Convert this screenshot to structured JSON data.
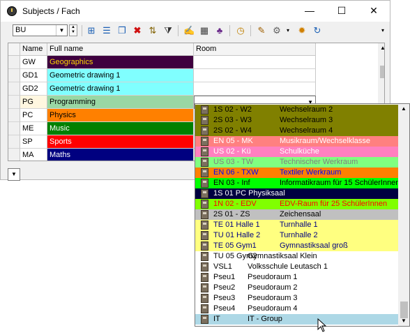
{
  "window": {
    "title": "Subjects / Fach",
    "min_glyph": "—",
    "max_glyph": "☐",
    "close_glyph": "✕"
  },
  "toolbar": {
    "combo_value": "BU"
  },
  "grid": {
    "columns": [
      "Name",
      "Full name",
      "Room"
    ],
    "rows": [
      {
        "name": "GW",
        "full": "Geographics",
        "bg": "#3f003f",
        "fg": "#ffd700"
      },
      {
        "name": "GD1",
        "full": "Geometric drawing 1",
        "bg": "#80ffff",
        "fg": "#000000"
      },
      {
        "name": "GD2",
        "full": "Geometric drawing 1",
        "bg": "#80ffff",
        "fg": "#000000"
      },
      {
        "name": "PG",
        "full": "Programming",
        "bg": "#99d7a4",
        "fg": "#000000"
      },
      {
        "name": "PC",
        "full": "Physics",
        "bg": "#ff8000",
        "fg": "#000000"
      },
      {
        "name": "ME",
        "full": "Music",
        "bg": "#008000",
        "fg": "#ffffff"
      },
      {
        "name": "SP",
        "full": "Sports",
        "bg": "#ff0000",
        "fg": "#ffffff"
      },
      {
        "name": "MA",
        "full": "Maths",
        "bg": "#000080",
        "fg": "#ffffff"
      }
    ]
  },
  "dropdown": {
    "items": [
      {
        "name": "1S 02 - W2",
        "full": "Wechselraum 2",
        "bg": "#808000",
        "fg": "#000000"
      },
      {
        "name": "2S 03 - W3",
        "full": "Wechselraum 3",
        "bg": "#808000",
        "fg": "#000000"
      },
      {
        "name": "2S 02 - W4",
        "full": "Wechselraum 4",
        "bg": "#808000",
        "fg": "#000000"
      },
      {
        "name": "EN 05 - MK",
        "full": "Musikraum/Wechselklasse",
        "bg": "#ff8080",
        "fg": "#ffffff"
      },
      {
        "name": "US 02 - Kü",
        "full": "Schulküche",
        "bg": "#ff80c0",
        "fg": "#ffffff"
      },
      {
        "name": "US 03 - TW",
        "full": "Technischer Werkraum",
        "bg": "#80ff80",
        "fg": "#808080"
      },
      {
        "name": "EN 06 - TXW",
        "full": "Textiler Werkraum",
        "bg": "#ff8000",
        "fg": "#0000ff"
      },
      {
        "name": "EN 03 - Inf",
        "full": "Informatikraum für 15 SchülerInnen",
        "bg": "#00ff00",
        "fg": "#000000"
      },
      {
        "name": "1S 01 PC Physiksaal",
        "full": "",
        "bg": "#000040",
        "fg": "#ffffff"
      },
      {
        "name": "1N 02 - EDV",
        "full": "EDV-Raum für 25 SchülerInnen",
        "bg": "#80ff00",
        "fg": "#ff0000"
      },
      {
        "name": "2S 01 - ZS",
        "full": "Zeichensaal",
        "bg": "#c0c0c0",
        "fg": "#000000"
      },
      {
        "name": "TE 01 Halle 1",
        "full": "Turnhalle 1",
        "bg": "#ffff80",
        "fg": "#000080"
      },
      {
        "name": "TU 01 Halle 2",
        "full": "Turnhalle 2",
        "bg": "#ffff80",
        "fg": "#000080"
      },
      {
        "name": "TE 05 Gym1",
        "full": "Gymnastiksaal groß",
        "bg": "#ffff80",
        "fg": "#000080"
      },
      {
        "name": "TU 05 Gym2",
        "full": "Gymnastiksaal Klein",
        "bg": "#ffffff",
        "fg": "#000000"
      },
      {
        "name": "VSL1",
        "full": "Volksschule Leutasch 1",
        "bg": "#ffffff",
        "fg": "#000000"
      },
      {
        "name": "Pseu1",
        "full": "Pseudoraum 1",
        "bg": "#ffffff",
        "fg": "#000000"
      },
      {
        "name": "Pseu2",
        "full": "Pseudoraum 2",
        "bg": "#ffffff",
        "fg": "#000000"
      },
      {
        "name": "Pseu3",
        "full": "Pseudoraum 3",
        "bg": "#ffffff",
        "fg": "#000000"
      },
      {
        "name": "Pseu4",
        "full": "Pseudoraum 4",
        "bg": "#ffffff",
        "fg": "#000000"
      },
      {
        "name": "IT",
        "full": "IT - Group",
        "bg": "#add8e6",
        "fg": "#000000"
      }
    ]
  }
}
